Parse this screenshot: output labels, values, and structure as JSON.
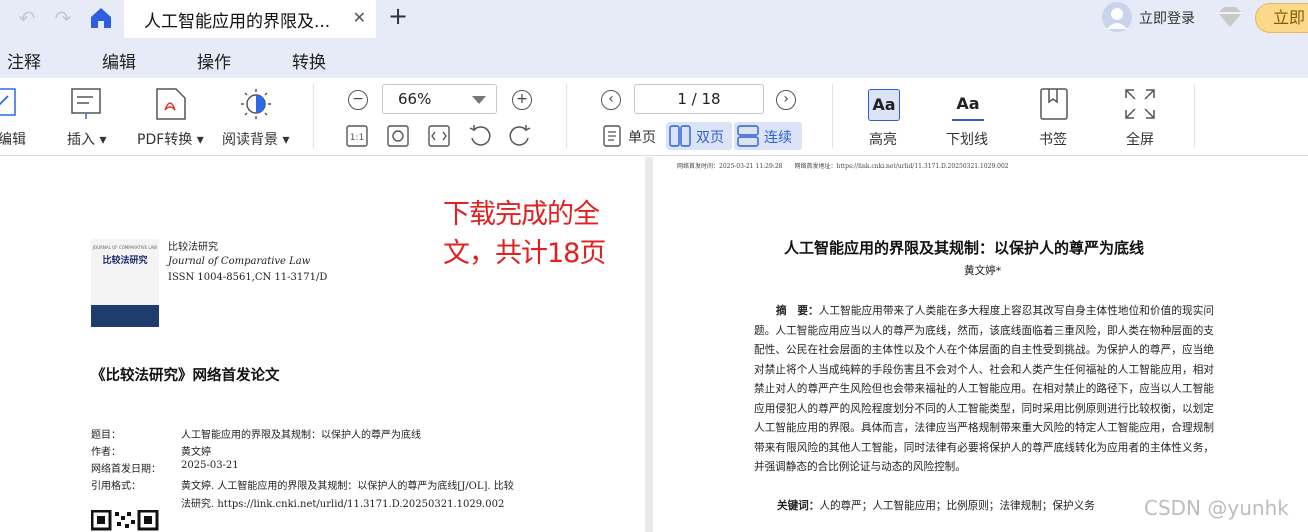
{
  "titlebar": {
    "tab_title": "人工智能应用的界限及...",
    "login_label": "立即登录",
    "vip_label": "立即"
  },
  "menubar": [
    "注释",
    "编辑",
    "操作",
    "转换"
  ],
  "toolbar": {
    "edit_label": "编辑",
    "insert_label": "插入",
    "pdf_convert_label": "PDF转换",
    "read_bg_label": "阅读背景",
    "zoom_value": "66%",
    "page_indicator": "1 / 18",
    "single_page_label": "单页",
    "double_page_label": "双页",
    "continuous_label": "连续",
    "highlight_label": "高亮",
    "underline_label": "下划线",
    "bookmark_label": "书签",
    "fullscreen_label": "全屏",
    "aa_text": "Aa"
  },
  "left_page": {
    "overlay_text": "下载完成的全文，共计18页",
    "journal_cn": "比较法研究",
    "journal_en": "Journal of Comparative Law",
    "issn": "ISSN 1004-8561,CN 11-3171/D",
    "cover_title": "比较法研究",
    "cover_sub": "JOURNAL OF COMPARATIVE LAW",
    "heading": "《比较法研究》网络首发论文",
    "meta_labels": [
      "题目：",
      "作者：",
      "网络首发日期：",
      "引用格式："
    ],
    "meta_title": "人工智能应用的界限及其规制：以保护人的尊严为底线",
    "meta_author": "黄文婷",
    "meta_date": "2025-03-21",
    "meta_cite_1": "黄文婷. 人工智能应用的界限及其规制：以保护人的尊严为底线[J/OL]. 比较",
    "meta_cite_2": "法研究. https://link.cnki.net/urlid/11.3171.D.20250321.1029.002"
  },
  "right_page": {
    "header_line": "网络首发时间：2025-03-21 11:29:28　　网络首发地址：https://link.cnki.net/urlid/11.3171.D.20250321.1029.002",
    "title": "人工智能应用的界限及其规制：以保护人的尊严为底线",
    "author": "黄文婷*",
    "abstract_label": "摘　要：",
    "abstract": "人工智能应用带来了人类能在多大程度上容忍其改写自身主体性地位和价值的现实问题。人工智能应用应当以人的尊严为底线，然而，该底线面临着三重风险，即人类在物种层面的支配性、公民在社会层面的主体性以及个人在个体层面的自主性受到挑战。为保护人的尊严，应当绝对禁止将个人当成纯粹的手段伤害且不会对个人、社会和人类产生任何福祉的人工智能应用，相对禁止对人的尊严产生风险但也会带来福祉的人工智能应用。在相对禁止的路径下，应当以人工智能应用侵犯人的尊严的风险程度划分不同的人工智能类型，同时采用比例原则进行比较权衡，以划定人工智能应用的界限。具体而言，法律应当严格规制带来重大风险的特定人工智能应用，合理规制带来有限风险的其他人工智能，同时法律有必要将保护人的尊严底线转化为应用者的主体性义务，并强调静态的合比例论证与动态的风险控制。",
    "keywords_label": "关键词：",
    "keywords": "人的尊严；人工智能应用；比例原则；法律规制；保护义务",
    "watermark": "CSDN @yunhk"
  }
}
